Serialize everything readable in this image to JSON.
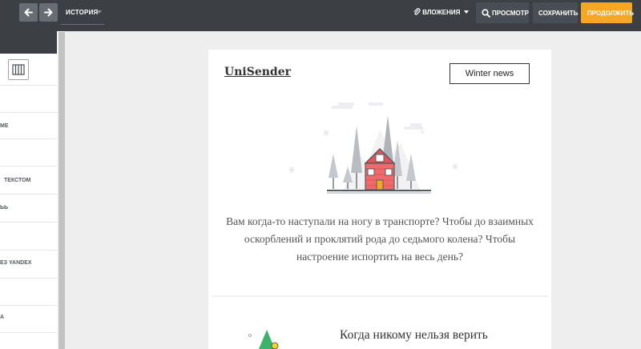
{
  "toolbar": {
    "history_label": "ИСТОРИЯ",
    "attachments_label": "ВЛОЖЕНИЯ",
    "preview_label": "ПРОСМОТР",
    "save_label": "СОХРАНИТЬ",
    "continue_label": "ПРОДОЛЖИТЬ",
    "accent_color": "#f5a623"
  },
  "sidebar": {
    "items": [
      {
        "label": "МЕ"
      },
      {
        "label": "ТЕКСТОМ"
      },
      {
        "label": "ЬЬ"
      },
      {
        "label": "ЕЗ YANDEX"
      },
      {
        "label": "А"
      }
    ]
  },
  "email": {
    "brand": "UniSender",
    "button": "Winter news",
    "body_text": "Вам когда-то наступали на ногу в транспорте? Чтобы до взаимных оскорблений и проклятий рода до седьмого колена? Чтобы настроение испортить на весь день?",
    "subtitle": "Когда никому нельзя верить"
  }
}
